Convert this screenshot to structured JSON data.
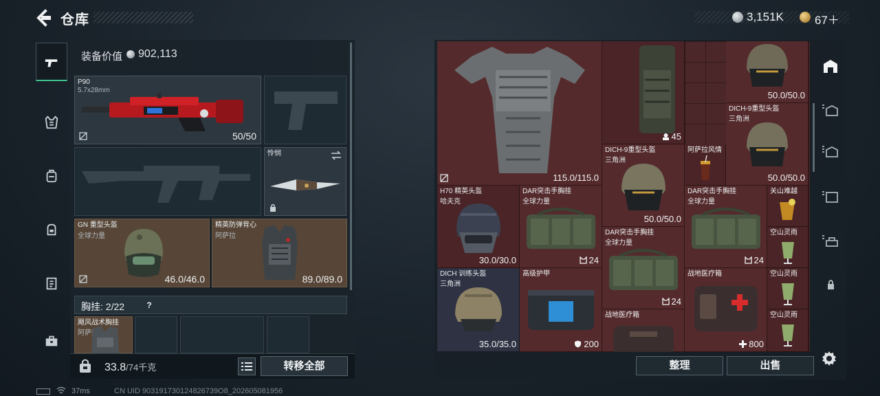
{
  "header": {
    "title": "仓库",
    "currencies": [
      {
        "icon": "silver-coin-icon",
        "amount": "3,151K"
      },
      {
        "icon": "gold-coin-icon",
        "amount": "67＋"
      }
    ]
  },
  "left_tabs": [
    {
      "icon": "pistol-icon",
      "active": true
    },
    {
      "icon": "vest-icon",
      "active": false
    },
    {
      "icon": "backpack-icon",
      "active": false
    },
    {
      "icon": "pouch-icon",
      "active": false
    },
    {
      "icon": "clipboard-icon",
      "active": false
    },
    {
      "icon": "toolbox-icon",
      "active": false
    }
  ],
  "loadout": {
    "equip_value_label": "装备价值",
    "equip_value_amount": "902,113",
    "primary_weapon": {
      "name": "P90",
      "caliber": "5.7x28mm",
      "ammo": "50/50"
    },
    "melee": {
      "name": "怜悯"
    },
    "helmet": {
      "name": "GN 重型头盔",
      "faction": "全球力量",
      "durability": "46.0/46.0"
    },
    "armor": {
      "name": "精英防弹背心",
      "faction": "阿萨拉",
      "durability": "89.0/89.0"
    },
    "vest_header": {
      "label": "胸挂:",
      "current": "2",
      "total": "/22",
      "help": "?"
    },
    "chest_rig": {
      "name": "飓风战术胸挂",
      "faction": "阿萨拉"
    },
    "weight": {
      "current": "33.8",
      "max": "/74千克"
    },
    "transfer_all_label": "转移全部"
  },
  "storage": {
    "items": [
      {
        "name": "",
        "faction": "",
        "value": "115.0/115.0"
      },
      {
        "name": "",
        "faction": "",
        "value": "45"
      },
      {
        "name": "",
        "faction": "",
        "value": "50.0/50.0"
      },
      {
        "name": "DICH-9重型头盔",
        "faction": "三角洲",
        "value": "50.0/50.0"
      },
      {
        "name": "DICH-9重型头盔",
        "faction": "三角洲",
        "value": "50.0/50.0"
      },
      {
        "name": "阿萨拉风情",
        "faction": "",
        "value": ""
      },
      {
        "name": "H70 精英头盔",
        "faction": "哈夫克",
        "value": "30.0/30.0"
      },
      {
        "name": "DAR突击手胸挂",
        "faction": "全球力量",
        "value": "24"
      },
      {
        "name": "DAR突击手胸挂",
        "faction": "全球力量",
        "value": "24"
      },
      {
        "name": "关山难越",
        "faction": "",
        "value": ""
      },
      {
        "name": "空山灵雨",
        "faction": "",
        "value": ""
      },
      {
        "name": "DAR突击手胸挂",
        "faction": "全球力量",
        "value": "24"
      },
      {
        "name": "DICH 训练头盔",
        "faction": "三角洲",
        "value": "35.0/35.0"
      },
      {
        "name": "高级护甲",
        "faction": "",
        "value": "200"
      },
      {
        "name": "战地医疗箱",
        "faction": "",
        "value": "800"
      },
      {
        "name": "空山灵雨",
        "faction": "",
        "value": ""
      },
      {
        "name": "空山灵雨",
        "faction": "",
        "value": ""
      },
      {
        "name": "战地医疗箱",
        "faction": "",
        "value": ""
      }
    ],
    "sort_label": "整理",
    "sell_label": "出售"
  },
  "right_tabs": [
    {
      "icon": "storage-house-icon",
      "active": true
    },
    {
      "icon": "storage-page-1-icon",
      "active": false
    },
    {
      "icon": "storage-page-2-icon",
      "active": false
    },
    {
      "icon": "storage-page-3-icon",
      "active": false
    },
    {
      "icon": "storage-page-4-icon",
      "active": false
    },
    {
      "icon": "locked-page-icon",
      "active": false
    }
  ],
  "status": {
    "ping": "37ms",
    "uid": "CN UID 903191730124826739O8_202605081956"
  },
  "colors": {
    "accent_green": "#3fc690",
    "grid_red": "#4c2729",
    "grid_navy": "#2e3242",
    "slot_brown": "#574637"
  }
}
